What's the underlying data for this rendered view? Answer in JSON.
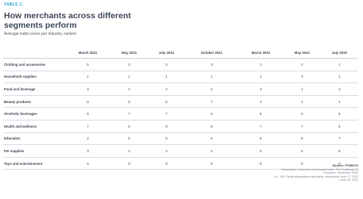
{
  "table_label": "TABLE 1:",
  "title": "How merchants across different segments perform",
  "subtitle": "Average index score per industry, ranked",
  "columns": [
    "March 2021",
    "May 2021",
    "July 2021",
    "October 2021",
    "March 2022",
    "May 2022",
    "July 2022"
  ],
  "rows": [
    {
      "label": "Clothing and accessories",
      "values": [
        "5",
        "3",
        "3",
        "3",
        "2",
        "2",
        "1"
      ]
    },
    {
      "label": "Household supplies",
      "values": [
        "1",
        "1",
        "1",
        "1",
        "1",
        "3",
        "2"
      ]
    },
    {
      "label": "Food and beverage",
      "values": [
        "4",
        "4",
        "2",
        "2",
        "3",
        "1",
        "3"
      ]
    },
    {
      "label": "Beauty products",
      "values": [
        "8",
        "8",
        "6",
        "7",
        "4",
        "4",
        "4"
      ]
    },
    {
      "label": "Alcoholic beverages",
      "values": [
        "6",
        "7",
        "7",
        "5",
        "6",
        "6",
        "5"
      ]
    },
    {
      "label": "Health and wellness",
      "values": [
        "7",
        "6",
        "8",
        "8",
        "7",
        "7",
        "6"
      ]
    },
    {
      "label": "Education",
      "values": [
        "2",
        "5",
        "5",
        "6",
        "8",
        "8",
        "7"
      ]
    },
    {
      "label": "Pet supplies",
      "values": [
        "3",
        "2",
        "4",
        "4",
        "5",
        "5",
        "8"
      ]
    },
    {
      "label": "Toys and entertainment",
      "values": [
        "9",
        "9",
        "9",
        "9",
        "9",
        "9",
        "9"
      ]
    }
  ],
  "footer": {
    "source": "Source: PYMNTS",
    "line1": "Subscription Commerce Conversion Index: The Challenge Of",
    "line2": "Choosers, September 2022",
    "line3": "N = 330; Retail subscription merchants, researched June 17, 2022",
    "line4": "– June 29, 2022"
  },
  "colors": {
    "accent": "#2a9fd6",
    "text": "#3d4756",
    "rule": "#d6dde4"
  }
}
